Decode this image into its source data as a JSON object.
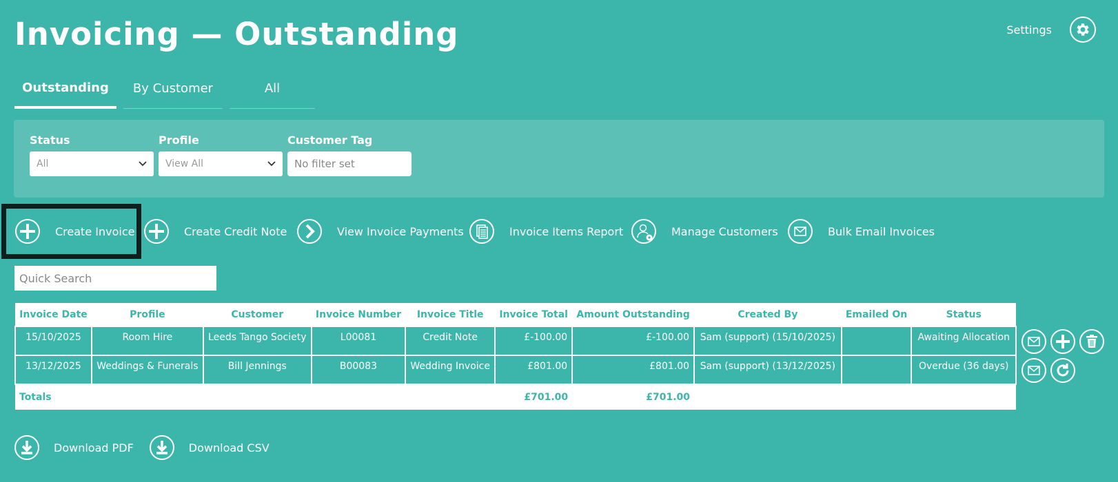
{
  "page": {
    "title": "Invoicing — Outstanding"
  },
  "header": {
    "settings_label": "Settings",
    "settings_icon": "gear-icon"
  },
  "tabs": [
    {
      "label": "Outstanding",
      "active": true
    },
    {
      "label": "By Customer",
      "active": false
    },
    {
      "label": "All",
      "active": false
    }
  ],
  "filters": {
    "status": {
      "label": "Status",
      "value": "All"
    },
    "profile": {
      "label": "Profile",
      "value": "View All"
    },
    "customer_tag": {
      "label": "Customer Tag",
      "placeholder": "No filter set"
    }
  },
  "actions": [
    {
      "label": "Create Invoice",
      "icon": "plus-circle-icon"
    },
    {
      "label": "Create Credit Note",
      "icon": "plus-circle-icon"
    },
    {
      "label": "View Invoice Payments",
      "icon": "chevron-right-circle-icon"
    },
    {
      "label": "Invoice Items Report",
      "icon": "documents-icon"
    },
    {
      "label": "Manage Customers",
      "icon": "user-gear-icon"
    },
    {
      "label": "Bulk Email Invoices",
      "icon": "envelope-icon"
    }
  ],
  "search": {
    "placeholder": "Quick Search"
  },
  "table": {
    "columns": [
      "Invoice Date",
      "Profile",
      "Customer",
      "Invoice Number",
      "Invoice Title",
      "Invoice Total",
      "Amount Outstanding",
      "Created By",
      "Emailed On",
      "Status"
    ],
    "rows": [
      {
        "date": "15/10/2025",
        "profile": "Room Hire",
        "customer": "Leeds Tango Society",
        "number": "L00081",
        "title": "Credit Note",
        "total": "£-100.00",
        "outstanding": "£-100.00",
        "created_by": "Sam (support) (15/10/2025)",
        "emailed_on": "",
        "status": "Awaiting Allocation"
      },
      {
        "date": "13/12/2025",
        "profile": "Weddings & Funerals",
        "customer": "Bill Jennings",
        "number": "B00083",
        "title": "Wedding Invoice",
        "total": "£801.00",
        "outstanding": "£801.00",
        "created_by": "Sam (support) (13/12/2025)",
        "emailed_on": "",
        "status": "Overdue (36 days)"
      }
    ],
    "totals": {
      "label": "Totals",
      "total": "£701.00",
      "outstanding": "£701.00"
    }
  },
  "downloads": [
    {
      "label": "Download PDF",
      "icon": "download-icon"
    },
    {
      "label": "Download CSV",
      "icon": "download-icon"
    }
  ],
  "colors": {
    "background": "#3cb6ab",
    "panel": "#5dc0b6",
    "highlight_border": "#0e1f1d",
    "text": "#ffffff"
  }
}
